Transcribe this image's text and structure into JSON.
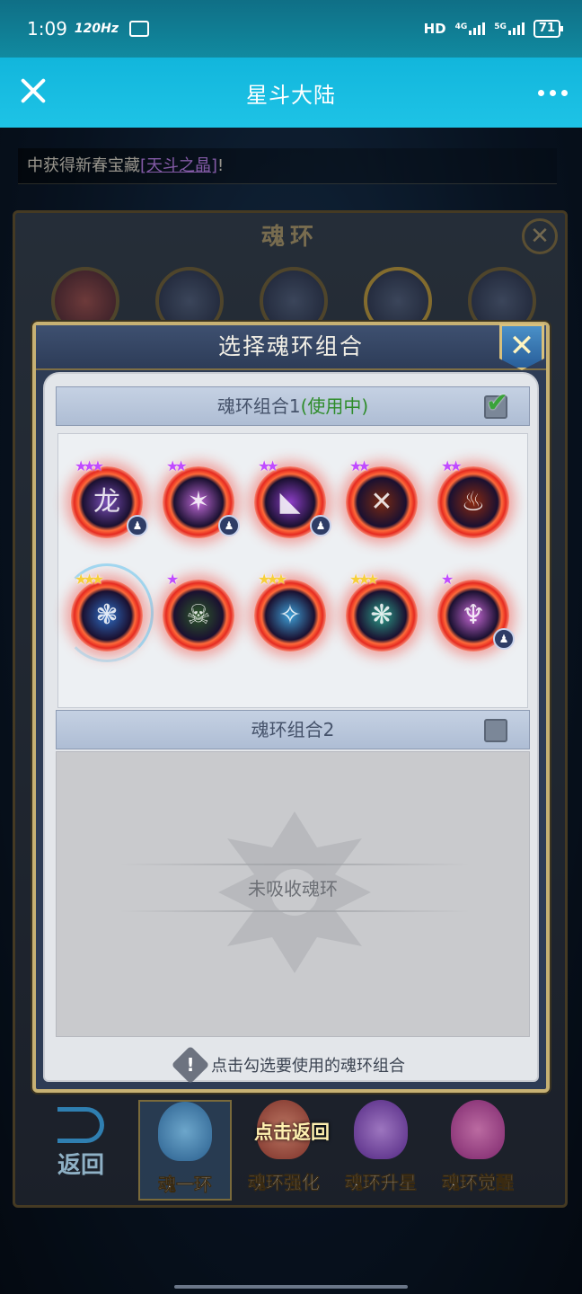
{
  "status_bar": {
    "time": "1:09",
    "refresh_rate": "120Hz",
    "network_labels": [
      "HD",
      "4G",
      "5G"
    ],
    "battery": "71"
  },
  "title_bar": {
    "title": "星斗大陆",
    "close_icon": "close-icon",
    "more_icon": "more-dots-icon"
  },
  "broadcast": {
    "prefix": "中获得新春宝藏",
    "treasure": "[天斗之晶]",
    "suffix": "!"
  },
  "outer_window": {
    "title": "魂环"
  },
  "modal": {
    "title": "选择魂环组合",
    "close_label": "✕",
    "group1": {
      "label": "魂环组合1",
      "status": "(使用中)",
      "checked": true
    },
    "group2": {
      "label": "魂环组合2",
      "checked": false,
      "empty_text": "未吸收魂环"
    },
    "hint": "点击勾选要使用的魂环组合",
    "rings": [
      {
        "stars": "★★★",
        "star_color": "purple",
        "core": "#7a4fb8",
        "glyph": "龙",
        "badge": true
      },
      {
        "stars": "★★",
        "star_color": "purple",
        "core": "#c06ad8",
        "glyph": "✶",
        "badge": true
      },
      {
        "stars": "★★",
        "star_color": "purple",
        "core": "#8e3fc8",
        "glyph": "◣",
        "badge": true
      },
      {
        "stars": "★★",
        "star_color": "purple",
        "core": "#7a2a12",
        "glyph": "✕",
        "badge": false
      },
      {
        "stars": "★★",
        "star_color": "purple",
        "core": "#8c2a10",
        "glyph": "♨",
        "badge": false
      },
      {
        "stars": "★★★",
        "star_color": "gold",
        "core": "#2f6fc8",
        "glyph": "❃",
        "badge": false
      },
      {
        "stars": "★",
        "star_color": "purple",
        "core": "#2e5a2a",
        "glyph": "☠",
        "badge": false
      },
      {
        "stars": "★★★",
        "star_color": "gold",
        "core": "#3ea0d8",
        "glyph": "✧",
        "badge": false
      },
      {
        "stars": "★★★",
        "star_color": "gold",
        "core": "#2ca08a",
        "glyph": "❋",
        "badge": false
      },
      {
        "stars": "★",
        "star_color": "purple",
        "core": "#c96ad8",
        "glyph": "♆",
        "badge": true
      }
    ]
  },
  "bottom_nav": {
    "back_label": "返回",
    "tap_back": "点击返回",
    "tabs": [
      {
        "label": "魂一环",
        "active": true
      },
      {
        "label": "魂环强化",
        "active": false
      },
      {
        "label": "魂环升星",
        "active": false
      },
      {
        "label": "魂环觉醒",
        "active": false
      }
    ]
  }
}
